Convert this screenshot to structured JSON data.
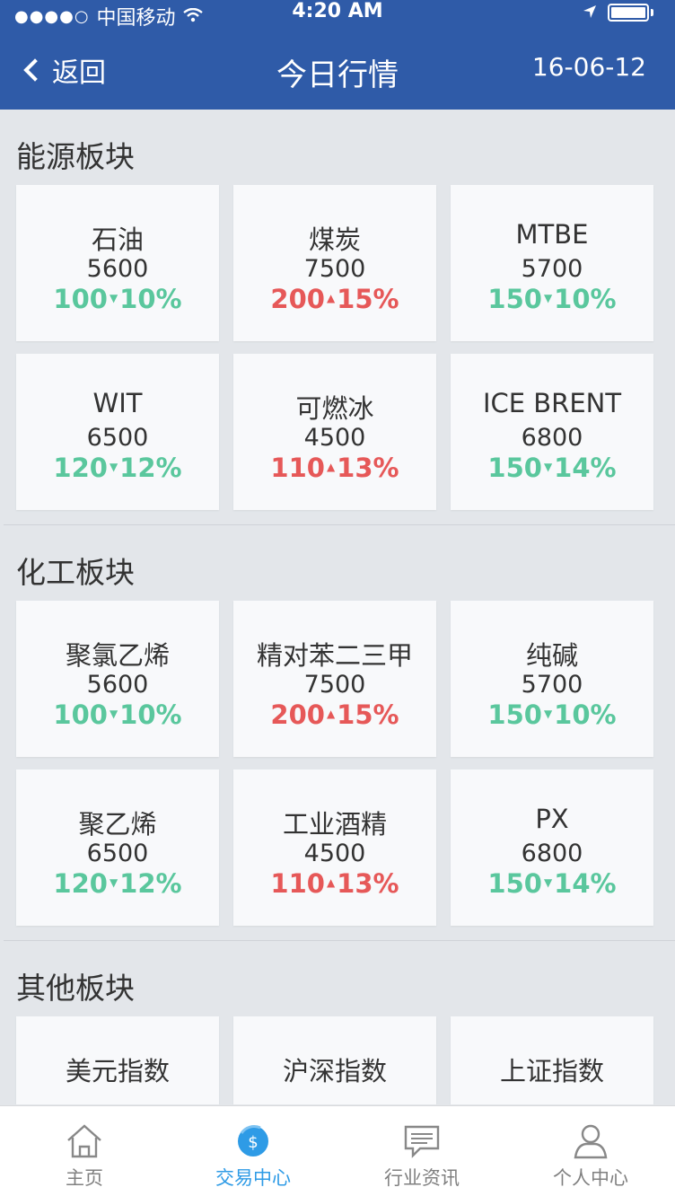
{
  "status": {
    "carrier": "中国移动",
    "time": "4:20 AM"
  },
  "nav": {
    "back": "返回",
    "title": "今日行情",
    "date": "16-06-12"
  },
  "sections": [
    {
      "title": "能源板块",
      "rows": [
        [
          {
            "name": "石油",
            "price": "5600",
            "change": "100",
            "pct": "10%",
            "dir": "down"
          },
          {
            "name": "煤炭",
            "price": "7500",
            "change": "200",
            "pct": "15%",
            "dir": "up"
          },
          {
            "name": "MTBE",
            "price": "5700",
            "change": "150",
            "pct": "10%",
            "dir": "down"
          }
        ],
        [
          {
            "name": "WIT",
            "price": "6500",
            "change": "120",
            "pct": "12%",
            "dir": "down"
          },
          {
            "name": "可燃冰",
            "price": "4500",
            "change": "110",
            "pct": "13%",
            "dir": "up"
          },
          {
            "name": "ICE BRENT",
            "price": "6800",
            "change": "150",
            "pct": "14%",
            "dir": "down"
          }
        ]
      ]
    },
    {
      "title": "化工板块",
      "rows": [
        [
          {
            "name": "聚氯乙烯",
            "price": "5600",
            "change": "100",
            "pct": "10%",
            "dir": "down"
          },
          {
            "name": "精对苯二三甲",
            "price": "7500",
            "change": "200",
            "pct": "15%",
            "dir": "up"
          },
          {
            "name": "纯碱",
            "price": "5700",
            "change": "150",
            "pct": "10%",
            "dir": "down"
          }
        ],
        [
          {
            "name": "聚乙烯",
            "price": "6500",
            "change": "120",
            "pct": "12%",
            "dir": "down"
          },
          {
            "name": "工业酒精",
            "price": "4500",
            "change": "110",
            "pct": "13%",
            "dir": "up"
          },
          {
            "name": "PX",
            "price": "6800",
            "change": "150",
            "pct": "14%",
            "dir": "down"
          }
        ]
      ]
    },
    {
      "title": "其他板块",
      "rows": [
        [
          {
            "name": "美元指数"
          },
          {
            "name": "沪深指数"
          },
          {
            "name": "上证指数"
          }
        ]
      ]
    }
  ],
  "tabs": [
    {
      "label": "主页",
      "icon": "home-icon",
      "active": false
    },
    {
      "label": "交易中心",
      "icon": "dollar-icon",
      "active": true
    },
    {
      "label": "行业资讯",
      "icon": "message-icon",
      "active": false
    },
    {
      "label": "个人中心",
      "icon": "user-icon",
      "active": false
    }
  ],
  "colors": {
    "header": "#2f5ba8",
    "up": "#e65858",
    "down": "#5ac79d",
    "tab_active": "#2e9be6"
  }
}
